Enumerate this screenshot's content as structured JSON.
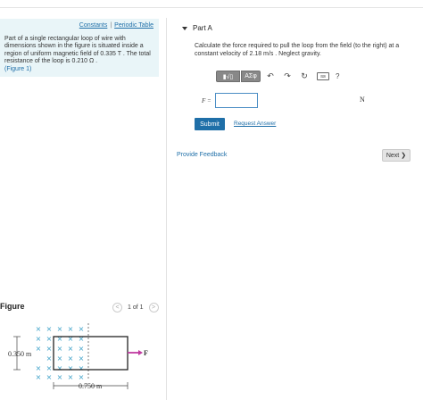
{
  "problem": {
    "links": [
      "Constants",
      "Periodic Table"
    ],
    "separator": "|",
    "text": "Part of a single rectangular loop of wire with dimensions shown in the figure is situated inside a region of uniform magnetic field of 0.335 T . The total resistance of the loop is 0.210 Ω .",
    "figure_link": "(Figure 1)"
  },
  "figure": {
    "title": "Figure",
    "pager_prev": "<",
    "pager_text": "1 of 1",
    "pager_next": ">",
    "height_label": "0.350 m",
    "width_label": "0.750 m",
    "force_label": "F",
    "field_symbol": "×"
  },
  "part_a": {
    "title": "Part A",
    "question": "Calculate the force required to pull the loop from the field (to the right) at a constant velocity of 2.18 m/s . Neglect gravity.",
    "toolbar": {
      "matrix_label": "▮√▯",
      "greek_label": "ΑΣφ",
      "undo_icon": "↶",
      "redo_icon": "↷",
      "reset_icon": "↻",
      "keyboard_icon": "⌨",
      "help_label": "?"
    },
    "answer_label": "F =",
    "answer_value": "",
    "unit": "N",
    "submit_label": "Submit",
    "request_label": "Request Answer"
  },
  "footer": {
    "feedback_label": "Provide Feedback",
    "next_label": "Next",
    "next_icon": "❯"
  },
  "colors": {
    "link": "#1f6fa8",
    "info_bg": "#e9f5f8",
    "submit_bg": "#1f6fa8",
    "field_x": "#3aa0c8",
    "force_arrow": "#c03aa0"
  }
}
